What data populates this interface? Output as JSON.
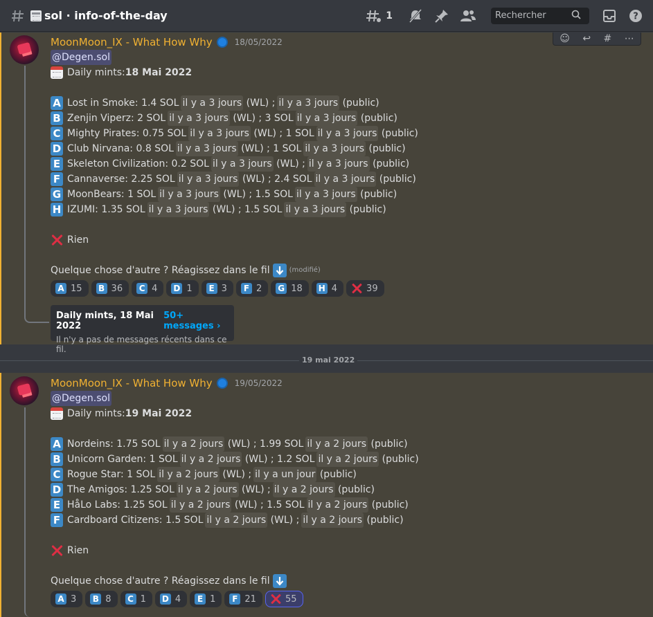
{
  "header": {
    "channel_name": "sol · info-of-the-day",
    "thread_count": "1",
    "search_placeholder": "Rechercher"
  },
  "messages": [
    {
      "author": "MoonMoon_IX -  What How Why",
      "timestamp": "18/05/2022",
      "mention": "@Degen.sol",
      "title_prefix": "Daily mints: ",
      "title_date": "18 Mai 2022",
      "items": [
        {
          "letter": "A",
          "text": "Lost in Smoke: 1.4 SOL",
          "t1": "il y a 3 jours",
          "mid": "(WL) ;",
          "t2": "il y a 3 jours",
          "end": "(public)"
        },
        {
          "letter": "B",
          "text": "Zenjin Viperz: 2 SOL",
          "t1": "il y a 3 jours",
          "mid": "(WL) ; 3 SOL",
          "t2": "il y a 3 jours",
          "end": "(public)"
        },
        {
          "letter": "C",
          "text": "Mighty Pirates: 0.75 SOL",
          "t1": "il y a 3 jours",
          "mid": "(WL) ; 1 SOL",
          "t2": "il y a 3 jours",
          "end": "(public)"
        },
        {
          "letter": "D",
          "text": "Club Nirvana: 0.8 SOL",
          "t1": "il y a 3 jours",
          "mid": "(WL) ; 1 SOL",
          "t2": "il y a 3 jours",
          "end": "(public)"
        },
        {
          "letter": "E",
          "text": "Skeleton Civilization: 0.2 SOL",
          "t1": "il y a 3 jours",
          "mid": "(WL) ;",
          "t2": "il y a 3 jours",
          "end": "(public)"
        },
        {
          "letter": "F",
          "text": "Cannaverse: 2.25 SOL",
          "t1": "il y a 3 jours",
          "mid": "(WL) ; 2.4 SOL",
          "t2": "il y a 3 jours",
          "end": "(public)"
        },
        {
          "letter": "G",
          "text": "MoonBears: 1 SOL",
          "t1": "il y a 3 jours",
          "mid": "(WL) ; 1.5 SOL",
          "t2": "il y a 3 jours",
          "end": "(public)"
        },
        {
          "letter": "H",
          "text": "IZUMI: 1.35 SOL",
          "t1": "il y a 3 jours",
          "mid": "(WL) ; 1.5 SOL",
          "t2": "il y a 3 jours",
          "end": "(public)"
        }
      ],
      "rien": "Rien",
      "question": "Quelque chose d'autre ? Réagissez dans le fil",
      "edited": "(modifié)",
      "reactions": [
        {
          "letter": "A",
          "count": "15"
        },
        {
          "letter": "B",
          "count": "36"
        },
        {
          "letter": "C",
          "count": "4"
        },
        {
          "letter": "D",
          "count": "1"
        },
        {
          "letter": "E",
          "count": "3"
        },
        {
          "letter": "F",
          "count": "2"
        },
        {
          "letter": "G",
          "count": "18"
        },
        {
          "letter": "H",
          "count": "4"
        },
        {
          "letter": "X",
          "count": "39"
        }
      ],
      "thread": {
        "title": "Daily mints, 18 Mai 2022",
        "link": "50+ messages ›",
        "subtitle": "Il n'y a pas de messages récents dans ce fil."
      }
    },
    {
      "author": "MoonMoon_IX -  What How Why",
      "timestamp": "19/05/2022",
      "mention": "@Degen.sol",
      "title_prefix": "Daily mints: ",
      "title_date": "19 Mai 2022",
      "items": [
        {
          "letter": "A",
          "text": "Nordeins: 1.75 SOL",
          "t1": "il y a 2 jours",
          "mid": "(WL) ; 1.99 SOL",
          "t2": "il y a 2 jours",
          "end": "(public)"
        },
        {
          "letter": "B",
          "text": "Unicorn Garden: 1 SOL",
          "t1": "il y a 2 jours",
          "mid": "(WL) ; 1.2 SOL",
          "t2": "il y a 2 jours",
          "end": "(public)"
        },
        {
          "letter": "C",
          "text": "Rogue Star: 1 SOL",
          "t1": "il y a 2 jours",
          "mid": "(WL) ;",
          "t2": "il y a un jour",
          "end": "(public)"
        },
        {
          "letter": "D",
          "text": "The Amigos: 1.25 SOL",
          "t1": "il y a 2 jours",
          "mid": "(WL) ;",
          "t2": "il y a 2 jours",
          "end": "(public)"
        },
        {
          "letter": "E",
          "text": "HåLo Labs: 1.25 SOL",
          "t1": "il y a 2 jours",
          "mid": "(WL) ; 1.5 SOL",
          "t2": "il y a 2 jours",
          "end": "(public)"
        },
        {
          "letter": "F",
          "text": "Cardboard Citizens: 1.5 SOL",
          "t1": "il y a 2 jours",
          "mid": "(WL) ;",
          "t2": "il y a 2 jours",
          "end": "(public)"
        }
      ],
      "rien": "Rien",
      "question": "Quelque chose d'autre ? Réagissez dans le fil",
      "reactions": [
        {
          "letter": "A",
          "count": "3"
        },
        {
          "letter": "B",
          "count": "8"
        },
        {
          "letter": "C",
          "count": "1"
        },
        {
          "letter": "D",
          "count": "4"
        },
        {
          "letter": "E",
          "count": "1"
        },
        {
          "letter": "F",
          "count": "21"
        },
        {
          "letter": "X",
          "count": "55",
          "active": true
        }
      ]
    }
  ],
  "date_divider": "19 mai 2022",
  "colors": {
    "accent_mention_bg": "#5865f2",
    "author": "#f0b132",
    "letter_badge": "#3c88c6",
    "link": "#00a8fc"
  }
}
